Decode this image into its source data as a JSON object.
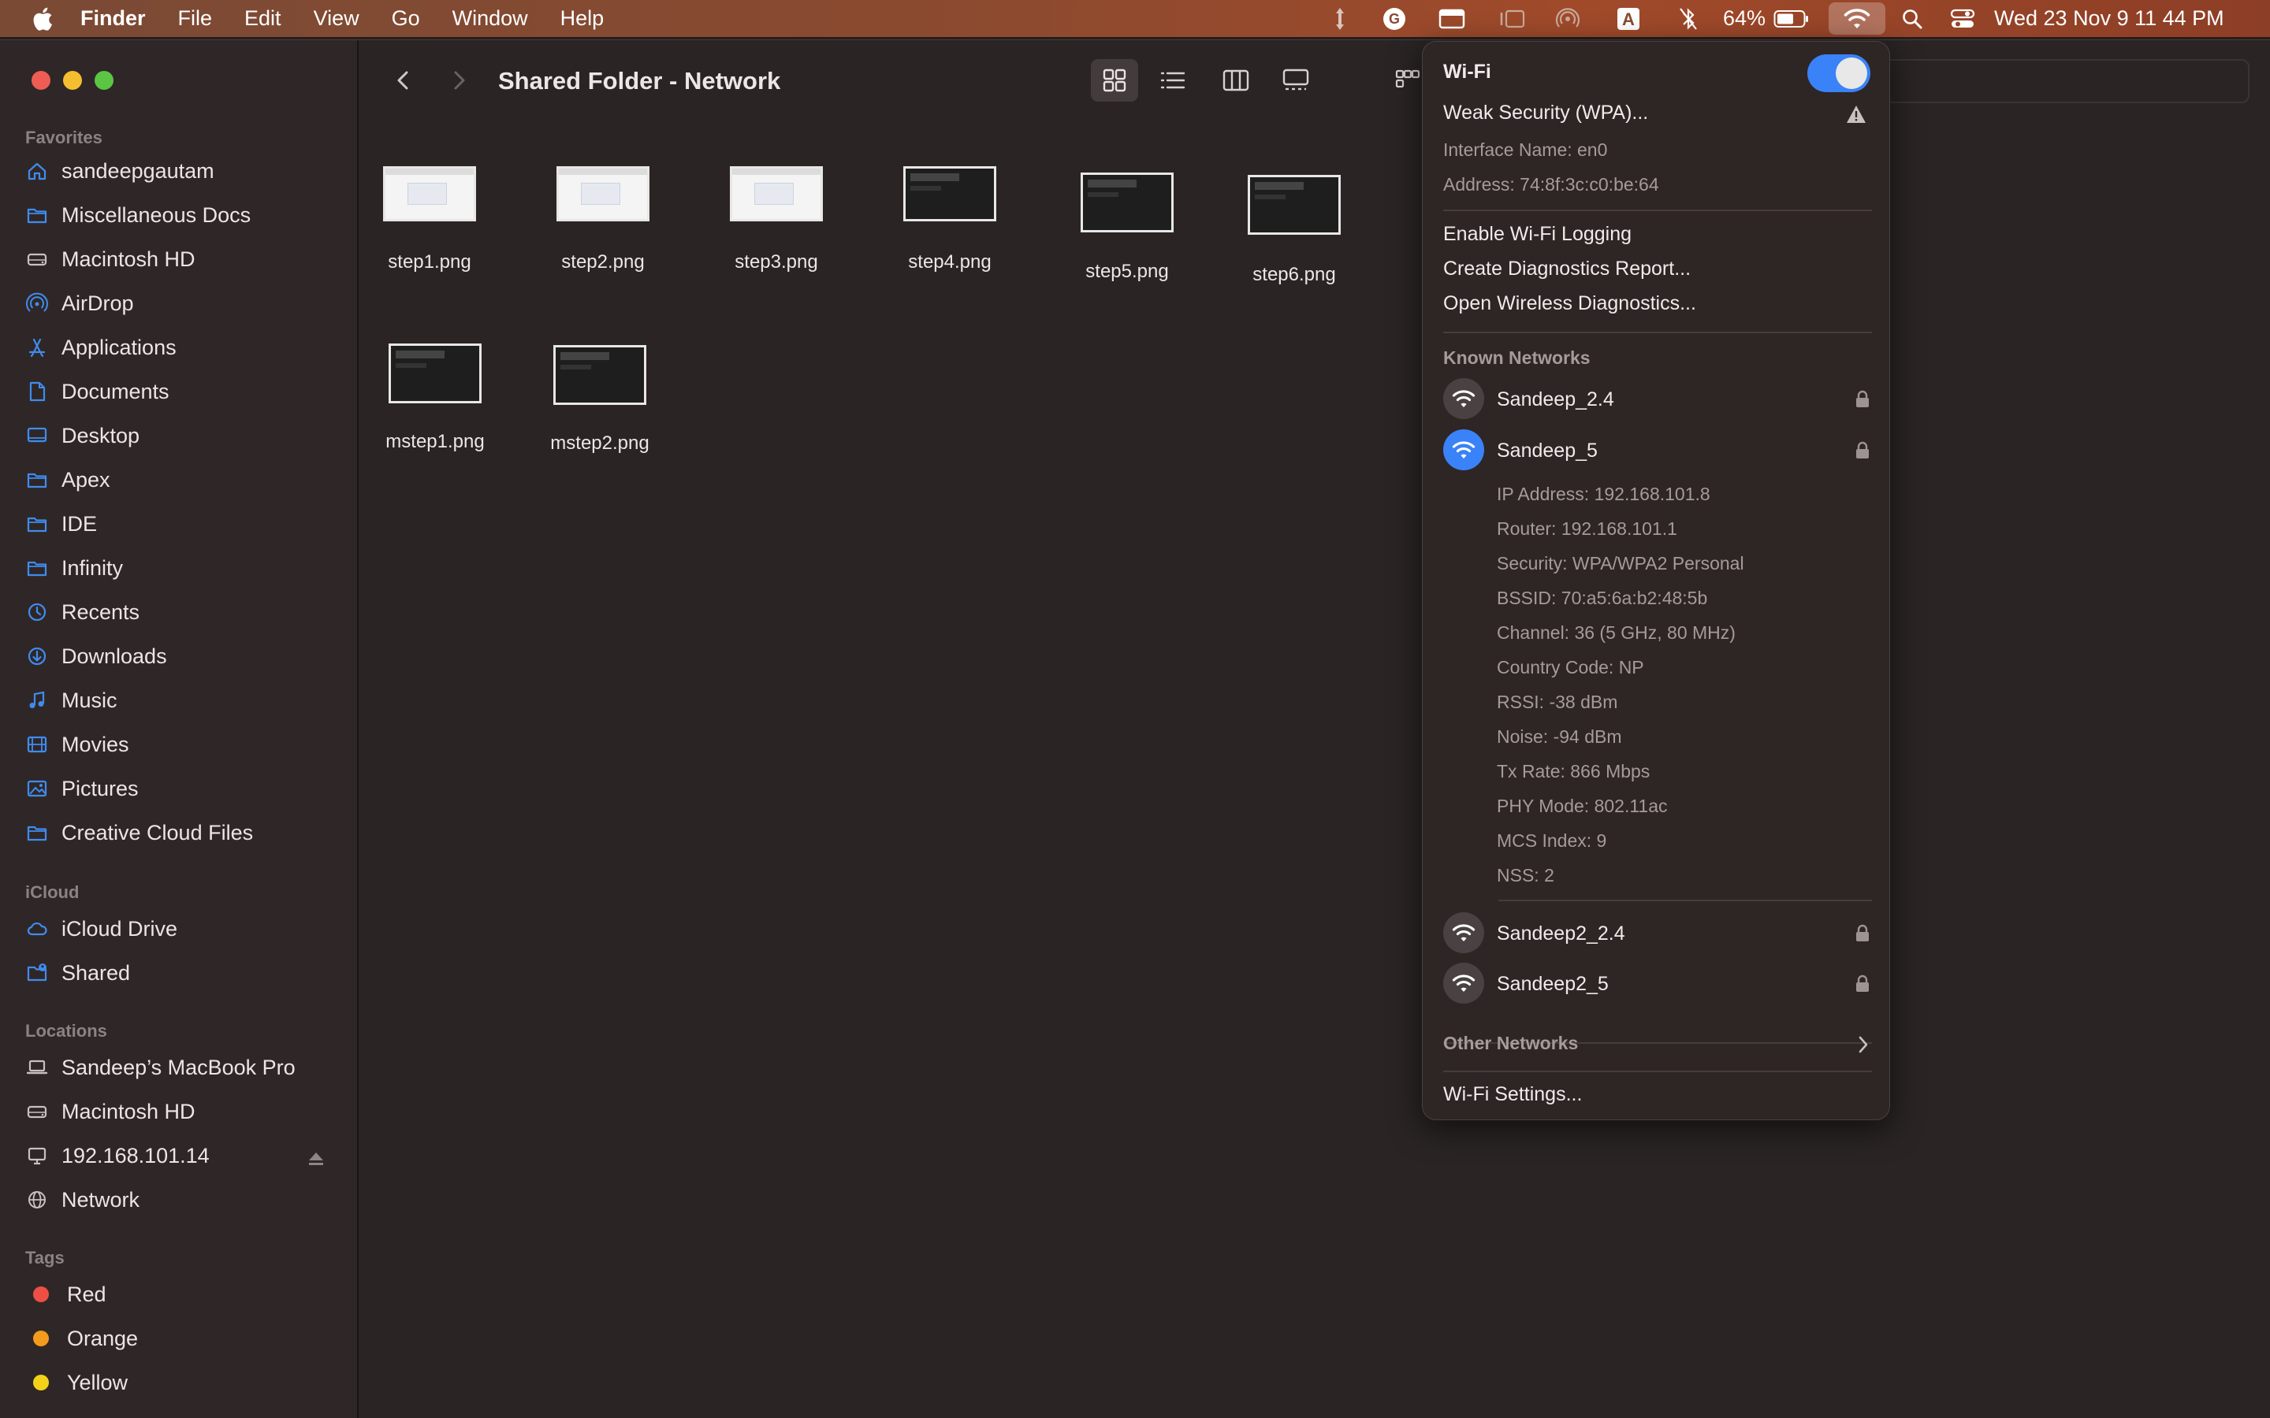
{
  "menubar": {
    "app_name": "Finder",
    "items": [
      "File",
      "Edit",
      "View",
      "Go",
      "Window",
      "Help"
    ],
    "battery_percent": "64%",
    "clock": "Wed 23 Nov  9 11 44 PM"
  },
  "window": {
    "title": "Shared Folder - Network"
  },
  "sidebar": {
    "favorites_heading": "Favorites",
    "favorites": [
      {
        "label": "sandeepgautam",
        "icon": "home-icon"
      },
      {
        "label": "Miscellaneous Docs",
        "icon": "folder-icon"
      },
      {
        "label": "Macintosh HD",
        "icon": "drive-icon"
      },
      {
        "label": "AirDrop",
        "icon": "airdrop-icon"
      },
      {
        "label": "Applications",
        "icon": "applications-icon"
      },
      {
        "label": "Documents",
        "icon": "document-icon"
      },
      {
        "label": "Desktop",
        "icon": "desktop-icon"
      },
      {
        "label": "Apex",
        "icon": "folder-icon"
      },
      {
        "label": "IDE",
        "icon": "folder-icon"
      },
      {
        "label": "Infinity",
        "icon": "folder-icon"
      },
      {
        "label": "Recents",
        "icon": "clock-icon"
      },
      {
        "label": "Downloads",
        "icon": "download-icon"
      },
      {
        "label": "Music",
        "icon": "music-icon"
      },
      {
        "label": "Movies",
        "icon": "film-icon"
      },
      {
        "label": "Pictures",
        "icon": "photo-icon"
      },
      {
        "label": "Creative Cloud Files",
        "icon": "folder-icon"
      }
    ],
    "icloud_heading": "iCloud",
    "icloud": [
      {
        "label": "iCloud Drive",
        "icon": "cloud-icon"
      },
      {
        "label": "Shared",
        "icon": "shared-folder-icon"
      }
    ],
    "locations_heading": "Locations",
    "locations": [
      {
        "label": "Sandeep’s MacBook Pro",
        "icon": "laptop-icon"
      },
      {
        "label": "Macintosh HD",
        "icon": "drive-icon"
      },
      {
        "label": "192.168.101.14",
        "icon": "monitor-icon"
      },
      {
        "label": "Network",
        "icon": "globe-icon"
      }
    ],
    "tags_heading": "Tags",
    "tags": [
      {
        "label": "Red",
        "color": "#ee4f45"
      },
      {
        "label": "Orange",
        "color": "#f39b1d"
      },
      {
        "label": "Yellow",
        "color": "#f5d21a"
      }
    ]
  },
  "files": [
    {
      "name": "step1.png"
    },
    {
      "name": "step2.png"
    },
    {
      "name": "step3.png"
    },
    {
      "name": "step4.png"
    },
    {
      "name": "step5.png"
    },
    {
      "name": "step6.png"
    },
    {
      "name": "mstep1.png"
    },
    {
      "name": "mstep2.png"
    }
  ],
  "wifi": {
    "title": "Wi-Fi",
    "enabled": true,
    "weak_security": "Weak Security (WPA)...",
    "interface_name": "Interface Name: en0",
    "address": "Address: 74:8f:3c:c0:be:64",
    "actions": [
      "Enable Wi-Fi Logging",
      "Create Diagnostics Report...",
      "Open Wireless Diagnostics..."
    ],
    "known_heading": "Known Networks",
    "networks_top": [
      {
        "name": "Sandeep_2.4",
        "connected": false
      },
      {
        "name": "Sandeep_5",
        "connected": true
      }
    ],
    "details": [
      "IP Address: 192.168.101.8",
      "Router: 192.168.101.1",
      "Security: WPA/WPA2 Personal",
      "BSSID: 70:a5:6a:b2:48:5b",
      "Channel: 36 (5 GHz, 80 MHz)",
      "Country Code: NP",
      "RSSI: -38 dBm",
      "Noise: -94 dBm",
      "Tx Rate: 866 Mbps",
      "PHY Mode: 802.11ac",
      "MCS Index: 9",
      "NSS: 2"
    ],
    "networks_bottom": [
      {
        "name": "Sandeep2_2.4",
        "connected": false
      },
      {
        "name": "Sandeep2_5",
        "connected": false
      }
    ],
    "other_networks": "Other Networks",
    "settings": "Wi-Fi Settings..."
  },
  "colors": {
    "accent_blue": "#3a82f7",
    "sidebar_icon_blue": "#3f8cf0"
  }
}
